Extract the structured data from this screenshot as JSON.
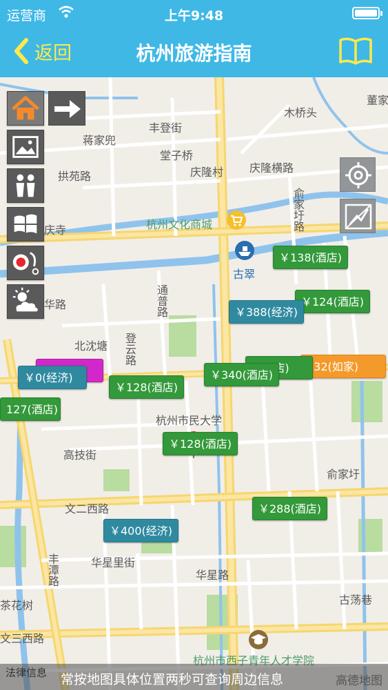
{
  "status": {
    "carrier": "运营商",
    "time": "上午9:48"
  },
  "nav": {
    "back_label": "返回",
    "title": "杭州旅游指南"
  },
  "map_labels": [
    {
      "id": "dongjia",
      "text": "董家"
    },
    {
      "id": "muqiaotou",
      "text": "木桥头"
    },
    {
      "id": "fengdengjie",
      "text": "丰登街"
    },
    {
      "id": "jiangjiadou",
      "text": "蒋家兜"
    },
    {
      "id": "tangziqiao",
      "text": "堂子桥"
    },
    {
      "id": "gongyuanlu",
      "text": "拱苑路"
    },
    {
      "id": "qinglongcun",
      "text": "庆隆村"
    },
    {
      "id": "qinglonghengl",
      "text": "庆隆横路"
    },
    {
      "id": "yujiawu",
      "text": "俞家圩路"
    },
    {
      "id": "wenhua",
      "text": "杭州文化商城"
    },
    {
      "id": "qingsi",
      "text": "庆寺"
    },
    {
      "id": "gucui",
      "text": "古翠"
    },
    {
      "id": "huahulu",
      "text": "华路"
    },
    {
      "id": "tongyilu",
      "text": "通普路"
    },
    {
      "id": "beishentang",
      "text": "北沈塘"
    },
    {
      "id": "dengyunlu",
      "text": "登云路"
    },
    {
      "id": "minsheng",
      "text": "杭州市民大学"
    },
    {
      "id": "gaojijie",
      "text": "高技街"
    },
    {
      "id": "yujiawu2",
      "text": "俞家圩"
    },
    {
      "id": "wenerxilu",
      "text": "文二西路"
    },
    {
      "id": "huaxingli",
      "text": "华星里街"
    },
    {
      "id": "fengtanlu",
      "text": "丰潭路"
    },
    {
      "id": "huaxinglu",
      "text": "华星路"
    },
    {
      "id": "gudanglu",
      "text": "古荡巷"
    },
    {
      "id": "chahuashu",
      "text": "茶花树"
    },
    {
      "id": "wensanxilu",
      "text": "文三西路"
    },
    {
      "id": "xizi",
      "text": "杭州市西子青年人才学院"
    }
  ],
  "tags": [
    {
      "id": "t1",
      "text": "￥138(酒店)",
      "color": "green"
    },
    {
      "id": "t2",
      "text": "￥124(酒店)",
      "color": "green"
    },
    {
      "id": "t3",
      "text": "￥388(经济)",
      "color": "blue"
    },
    {
      "id": "t4",
      "text": "￥340(酒店)",
      "color": "green"
    },
    {
      "id": "t5",
      "text": "8(酒店)",
      "color": "green"
    },
    {
      "id": "t6",
      "text": "132(如家)",
      "color": "orange"
    },
    {
      "id": "t7",
      "text": "￥0(经济)",
      "color": "blue"
    },
    {
      "id": "t8",
      "text": "￥128(酒店)",
      "color": "green"
    },
    {
      "id": "t9",
      "text": "127(酒店)",
      "color": "green"
    },
    {
      "id": "t10",
      "text": "￥128(酒店)",
      "color": "green"
    },
    {
      "id": "t11",
      "text": "￥288(酒店)",
      "color": "green"
    },
    {
      "id": "t12",
      "text": "￥400(经济)",
      "color": "blue"
    }
  ],
  "footer": {
    "legal": "法律信息",
    "hint": "常按地图具体位置两秒可查询周边信息",
    "brand": "高德地图"
  },
  "colors": {
    "nav_bg": "#3fb8e6",
    "accent": "#ffe94a",
    "tag_green": "#33993a",
    "tag_blue": "#2f8aa0",
    "tag_orange": "#f39a2a",
    "tag_magenta": "#d228c9"
  },
  "icons": [
    "wifi-icon",
    "battery-icon",
    "back-chevron-icon",
    "book-icon",
    "home-icon",
    "forward-arrow-icon",
    "photo-icon",
    "people-icon",
    "windows-icon",
    "food-icon",
    "weather-icon",
    "locate-icon",
    "route-icon",
    "location-pin-icon",
    "shopping-cart-icon",
    "boat-icon",
    "graduation-icon"
  ]
}
